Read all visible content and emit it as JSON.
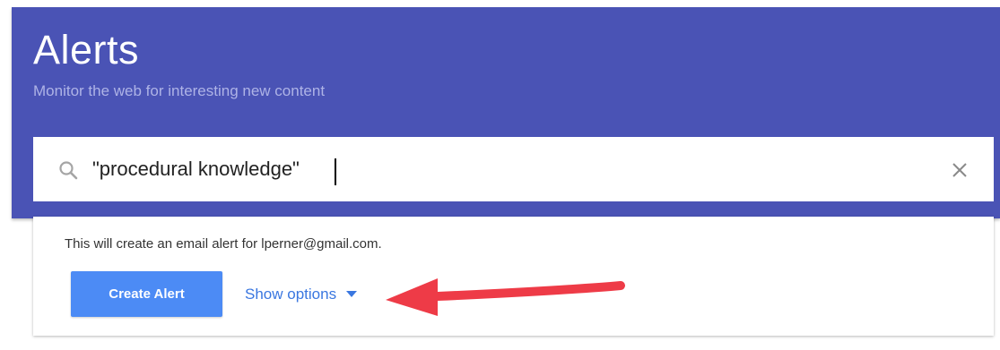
{
  "header": {
    "title": "Alerts",
    "subtitle": "Monitor the web for interesting new content",
    "background_color": "#4a53b5"
  },
  "search": {
    "value": "\"procedural knowledge\"",
    "search_icon": "search-icon",
    "clear_icon": "close-icon"
  },
  "panel": {
    "notice": "This will create an email alert for lperner@gmail.com.",
    "create_button_label": "Create Alert",
    "options_label": "Show options",
    "options_icon": "chevron-down-icon",
    "accent_color": "#4c8bf5"
  },
  "annotation": {
    "arrow_color": "#ee3b47"
  }
}
